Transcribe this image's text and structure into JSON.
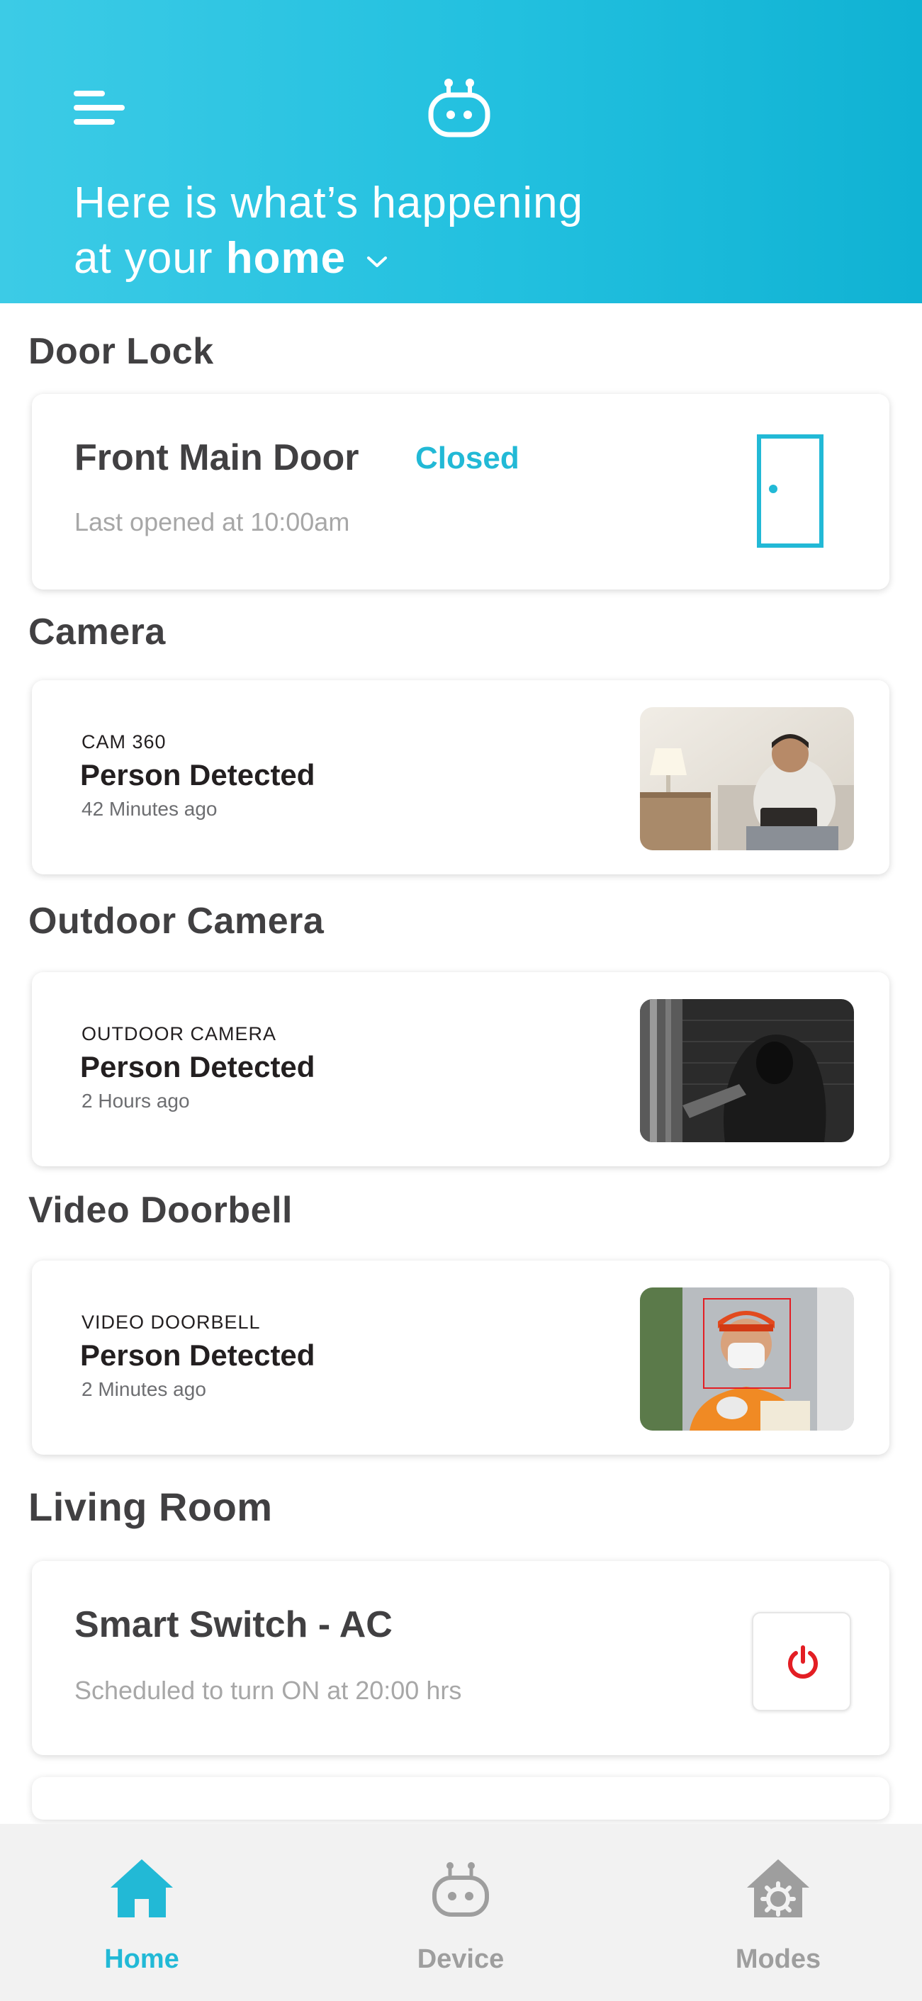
{
  "header": {
    "line1": "Here is what’s happening",
    "line2_prefix": "at your",
    "location": "home"
  },
  "door_lock": {
    "section_title": "Door Lock",
    "name": "Front Main Door",
    "status": "Closed",
    "last_opened": "Last opened at 10:00am"
  },
  "cameras": [
    {
      "section_title": "Camera",
      "device_label": "CAM 360",
      "event": "Person Detected",
      "time": "42 Minutes ago"
    },
    {
      "section_title": "Outdoor Camera",
      "device_label": "OUTDOOR CAMERA",
      "event": "Person Detected",
      "time": "2 Hours ago"
    },
    {
      "section_title": "Video Doorbell",
      "device_label": "VIDEO DOORBELL",
      "event": "Person Detected",
      "time": "2 Minutes ago"
    }
  ],
  "living_room": {
    "section_title": "Living Room",
    "switch_name": "Smart Switch - AC",
    "schedule": "Scheduled to turn ON at 20:00 hrs"
  },
  "bottom_nav": {
    "items": [
      {
        "label": "Home",
        "icon": "house-icon",
        "active": true
      },
      {
        "label": "Device",
        "icon": "robot-icon",
        "active": false
      },
      {
        "label": "Modes",
        "icon": "house-gear-icon",
        "active": false
      }
    ]
  },
  "colors": {
    "accent": "#22b9d6",
    "header_gradient_start": "#3ccbe6",
    "header_gradient_end": "#10b2d3",
    "power_red": "#e31e24",
    "text_dark": "#414042",
    "text_muted": "#a7a7a7",
    "nav_inactive": "#9e9e9e",
    "nav_bg": "#f2f2f2"
  }
}
